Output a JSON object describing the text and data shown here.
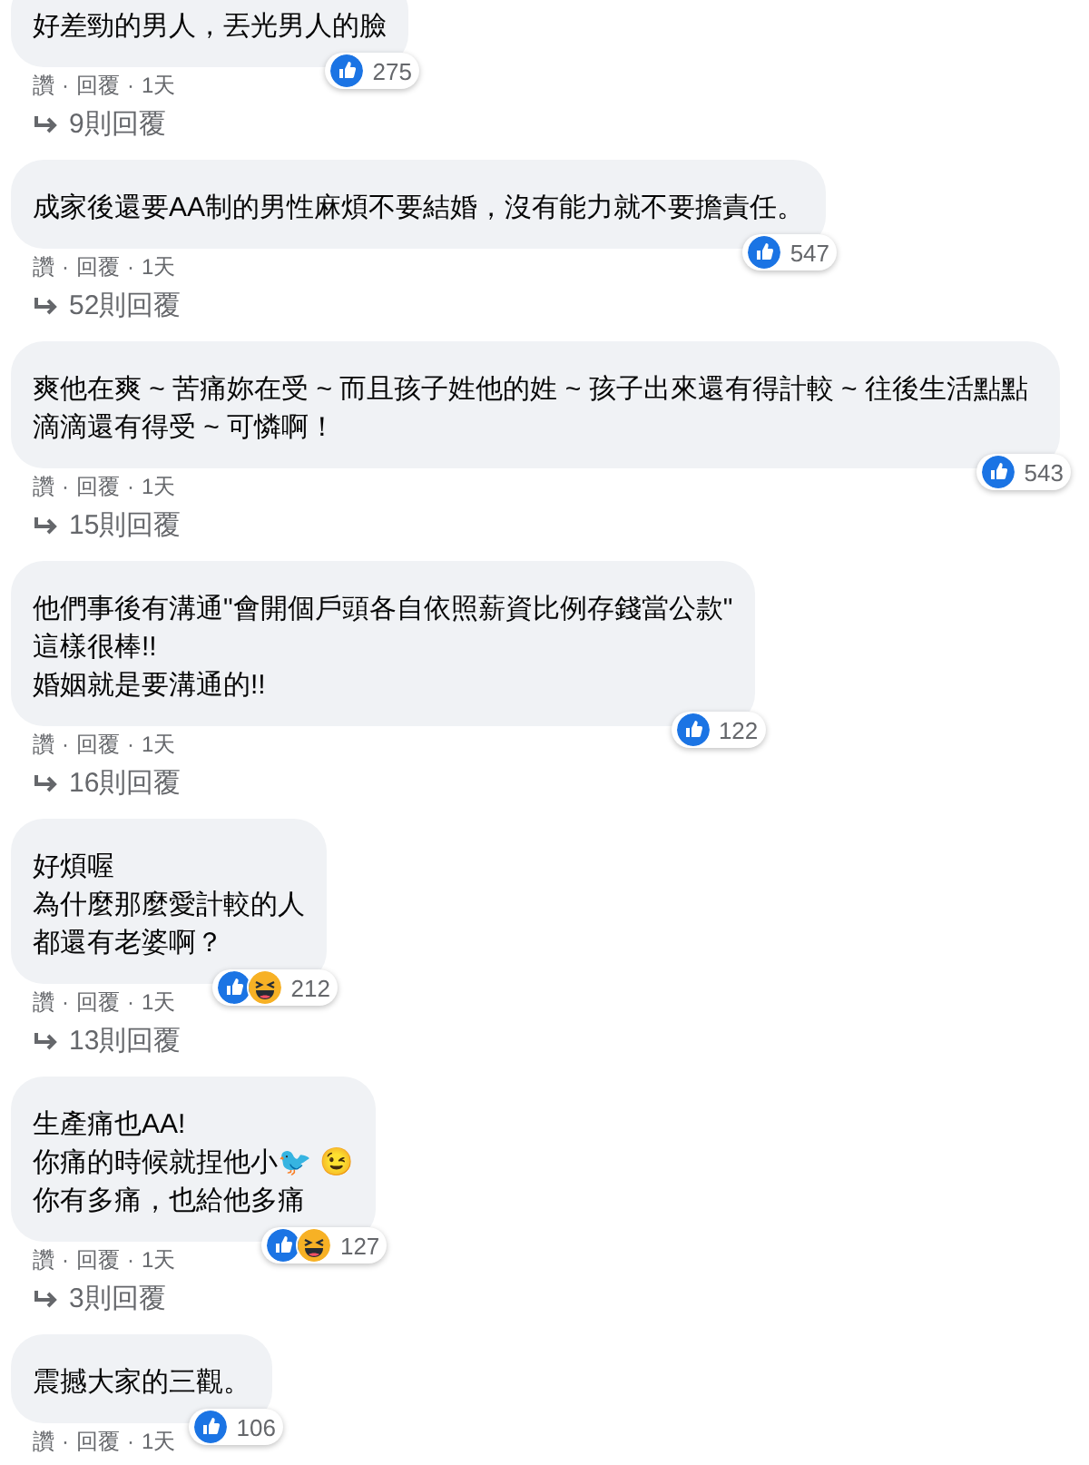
{
  "comments": [
    {
      "lines": [
        "好差勁的男人，丟光男人的臉"
      ],
      "reactions": [
        {
          "kind": "like"
        }
      ],
      "count": "275",
      "actions": [
        {
          "kind": "link",
          "text": "讚"
        },
        {
          "kind": "dot",
          "text": "·"
        },
        {
          "kind": "link",
          "text": "回覆"
        },
        {
          "kind": "dot",
          "text": "·"
        },
        {
          "kind": "time",
          "text": "1天"
        }
      ],
      "replies": "9則回覆"
    },
    {
      "lines": [
        "成家後還要AA制的男性麻煩不要結婚，沒有能力就不要擔責任。"
      ],
      "reactions": [
        {
          "kind": "like"
        }
      ],
      "count": "547",
      "actions": [
        {
          "kind": "link",
          "text": "讚"
        },
        {
          "kind": "dot",
          "text": "·"
        },
        {
          "kind": "link",
          "text": "回覆"
        },
        {
          "kind": "dot",
          "text": "·"
        },
        {
          "kind": "time",
          "text": "1天"
        }
      ],
      "replies": "52則回覆"
    },
    {
      "lines": [
        "爽他在爽 ~ 苦痛妳在受 ~ 而且孩子姓他的姓 ~ 孩子出來還有得計較 ~ 往後生活點點滴滴還有得受 ~ 可憐啊！"
      ],
      "reactions": [
        {
          "kind": "like"
        }
      ],
      "count": "543",
      "actions": [
        {
          "kind": "link",
          "text": "讚"
        },
        {
          "kind": "dot",
          "text": "·"
        },
        {
          "kind": "link",
          "text": "回覆"
        },
        {
          "kind": "dot",
          "text": "·"
        },
        {
          "kind": "time",
          "text": "1天"
        }
      ],
      "replies": "15則回覆"
    },
    {
      "lines": [
        "他們事後有溝通\"會開個戶頭各自依照薪資比例存錢當公款\"",
        "這樣很棒!!",
        "婚姻就是要溝通的!!"
      ],
      "reactions": [
        {
          "kind": "like"
        }
      ],
      "count": "122",
      "actions": [
        {
          "kind": "link",
          "text": "讚"
        },
        {
          "kind": "dot",
          "text": "·"
        },
        {
          "kind": "link",
          "text": "回覆"
        },
        {
          "kind": "dot",
          "text": "·"
        },
        {
          "kind": "time",
          "text": "1天"
        }
      ],
      "replies": "16則回覆"
    },
    {
      "lines": [
        "好煩喔",
        "為什麼那麼愛計較的人",
        "都還有老婆啊？"
      ],
      "reactions": [
        {
          "kind": "like"
        },
        {
          "kind": "haha"
        }
      ],
      "count": "212",
      "actions": [
        {
          "kind": "link",
          "text": "讚"
        },
        {
          "kind": "dot",
          "text": "·"
        },
        {
          "kind": "link",
          "text": "回覆"
        },
        {
          "kind": "dot",
          "text": "·"
        },
        {
          "kind": "time",
          "text": "1天"
        }
      ],
      "replies": "13則回覆"
    },
    {
      "lines": [
        "生產痛也AA!",
        "你痛的時候就捏他小🐦 😉",
        "你有多痛，也給他多痛"
      ],
      "reactions": [
        {
          "kind": "like"
        },
        {
          "kind": "haha"
        }
      ],
      "count": "127",
      "actions": [
        {
          "kind": "link",
          "text": "讚"
        },
        {
          "kind": "dot",
          "text": "·"
        },
        {
          "kind": "link",
          "text": "回覆"
        },
        {
          "kind": "dot",
          "text": "·"
        },
        {
          "kind": "time",
          "text": "1天"
        }
      ],
      "replies": "3則回覆"
    },
    {
      "lines": [
        "震撼大家的三觀。"
      ],
      "reactions": [
        {
          "kind": "like"
        }
      ],
      "count": "106",
      "actions": [
        {
          "kind": "link",
          "text": "讚"
        },
        {
          "kind": "dot",
          "text": "·"
        },
        {
          "kind": "link",
          "text": "回覆"
        },
        {
          "kind": "dot",
          "text": "·"
        },
        {
          "kind": "time",
          "text": "1天"
        }
      ]
    }
  ]
}
